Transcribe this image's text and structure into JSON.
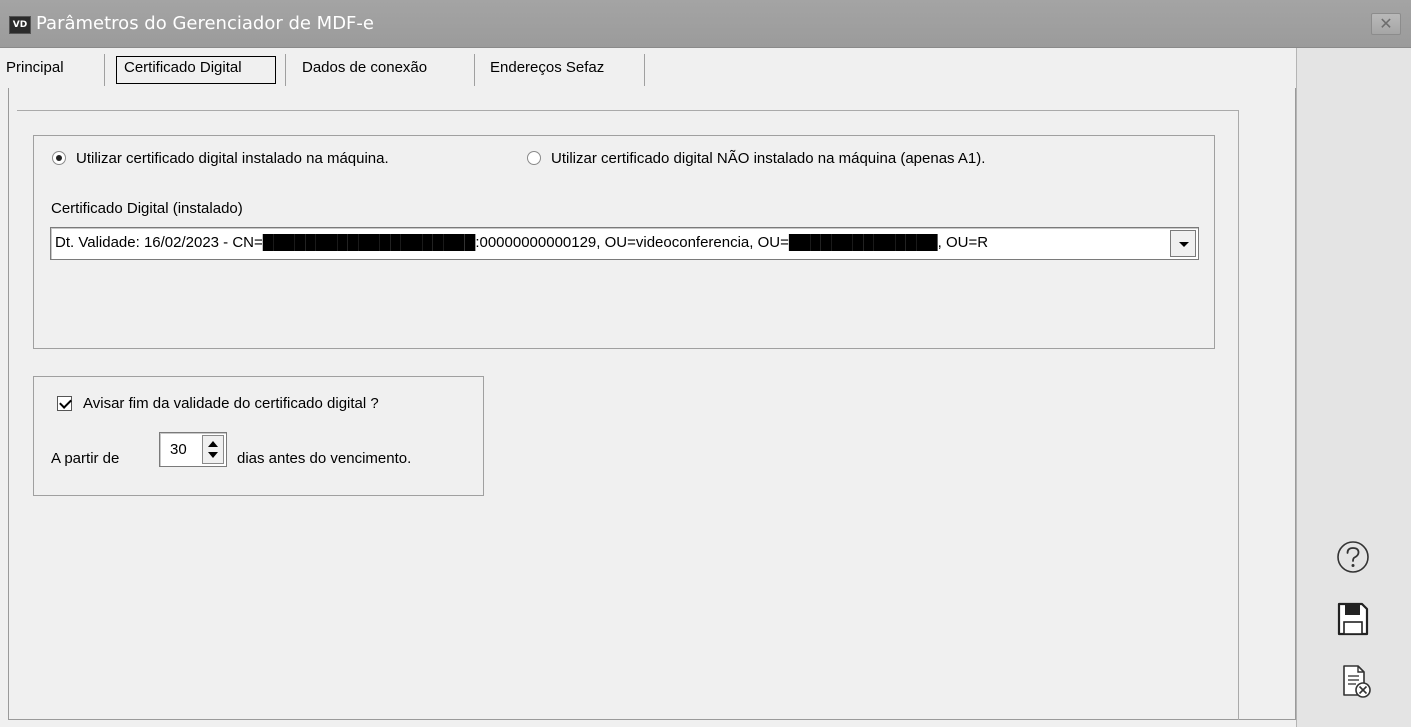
{
  "window": {
    "icon_text": "VD",
    "title": "Parâmetros do Gerenciador de MDF-e",
    "close_glyph": "✕"
  },
  "tabs": [
    {
      "label": "Principal",
      "active": false
    },
    {
      "label": "Certificado Digital",
      "active": true
    },
    {
      "label": "Dados de conexão",
      "active": false
    },
    {
      "label": "Endereços Sefaz",
      "active": false
    }
  ],
  "certificate": {
    "radio_installed_label": "Utilizar certificado digital instalado na máquina.",
    "radio_installed_checked": true,
    "radio_not_installed_label": "Utilizar certificado digital NÃO instalado na máquina (apenas A1).",
    "radio_not_installed_checked": false,
    "combo_label": "Certificado Digital (instalado)",
    "combo_value": "Dt. Validade: 16/02/2023 - CN=████████████████████:00000000000129, OU=videoconferencia, OU=██████████████, OU=R"
  },
  "expiry": {
    "warn_label": "Avisar fim da validade do certificado digital ?",
    "warn_checked": true,
    "from_label": "A partir de",
    "days_value": "30",
    "days_suffix": "dias antes do vencimento."
  },
  "side_actions": {
    "help_icon": "help-icon",
    "save_icon": "save-icon",
    "cancel_icon": "cancel-document-icon"
  }
}
